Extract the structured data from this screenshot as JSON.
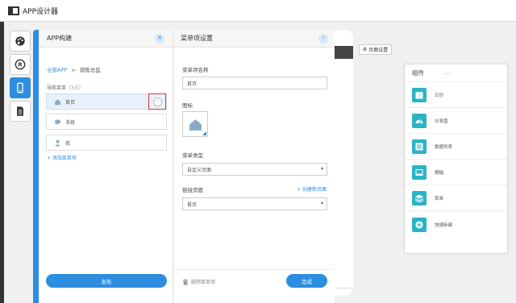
{
  "app": {
    "title": "APP设计器"
  },
  "sidebar_tools": [
    {
      "icon": "palette-icon"
    },
    {
      "icon": "registered-icon"
    },
    {
      "icon": "mobile-icon",
      "active": true
    },
    {
      "icon": "document-icon"
    }
  ],
  "app_panel": {
    "title": "APP构建",
    "breadcrumb": {
      "root": "全部APP",
      "separator": ">",
      "current": "销售总监"
    },
    "nav_label": "导航菜单",
    "nav_count": "（3/5）",
    "menu_items": [
      {
        "label": "首页",
        "icon": "home-icon",
        "selected": true
      },
      {
        "label": "消息",
        "icon": "chat-bubble-icon"
      },
      {
        "label": "我",
        "icon": "person-icon"
      }
    ],
    "more_symbol": "···",
    "add_item": "+ 添加菜单项",
    "publish": "发布"
  },
  "menu_panel": {
    "title": "菜单项设置",
    "name_label": "菜单项名称",
    "name_value": "首页",
    "icon_label": "图标",
    "type_label": "菜单类型",
    "type_value": "自定义页面",
    "link_label": "链接页面",
    "create_page": "+ 创建新页面",
    "link_value": "首页",
    "delete": "删除菜单项",
    "done": "完成"
  },
  "page_settings": "页面设置",
  "components": {
    "title": "组件",
    "dots": ".....",
    "items": [
      {
        "label": "日历",
        "icon": "calendar-icon"
      },
      {
        "label": "仪表盘",
        "icon": "gauge-icon"
      },
      {
        "label": "数据列表",
        "icon": "list-icon"
      },
      {
        "label": "横幅",
        "icon": "banner-icon"
      },
      {
        "label": "菜单",
        "icon": "layers-icon"
      },
      {
        "label": "快捷新建",
        "icon": "plus-circle-icon"
      }
    ]
  },
  "colors": {
    "accent": "#2d8ee0",
    "component_icon": "#2bb3c8",
    "highlight_border": "#e23636"
  }
}
